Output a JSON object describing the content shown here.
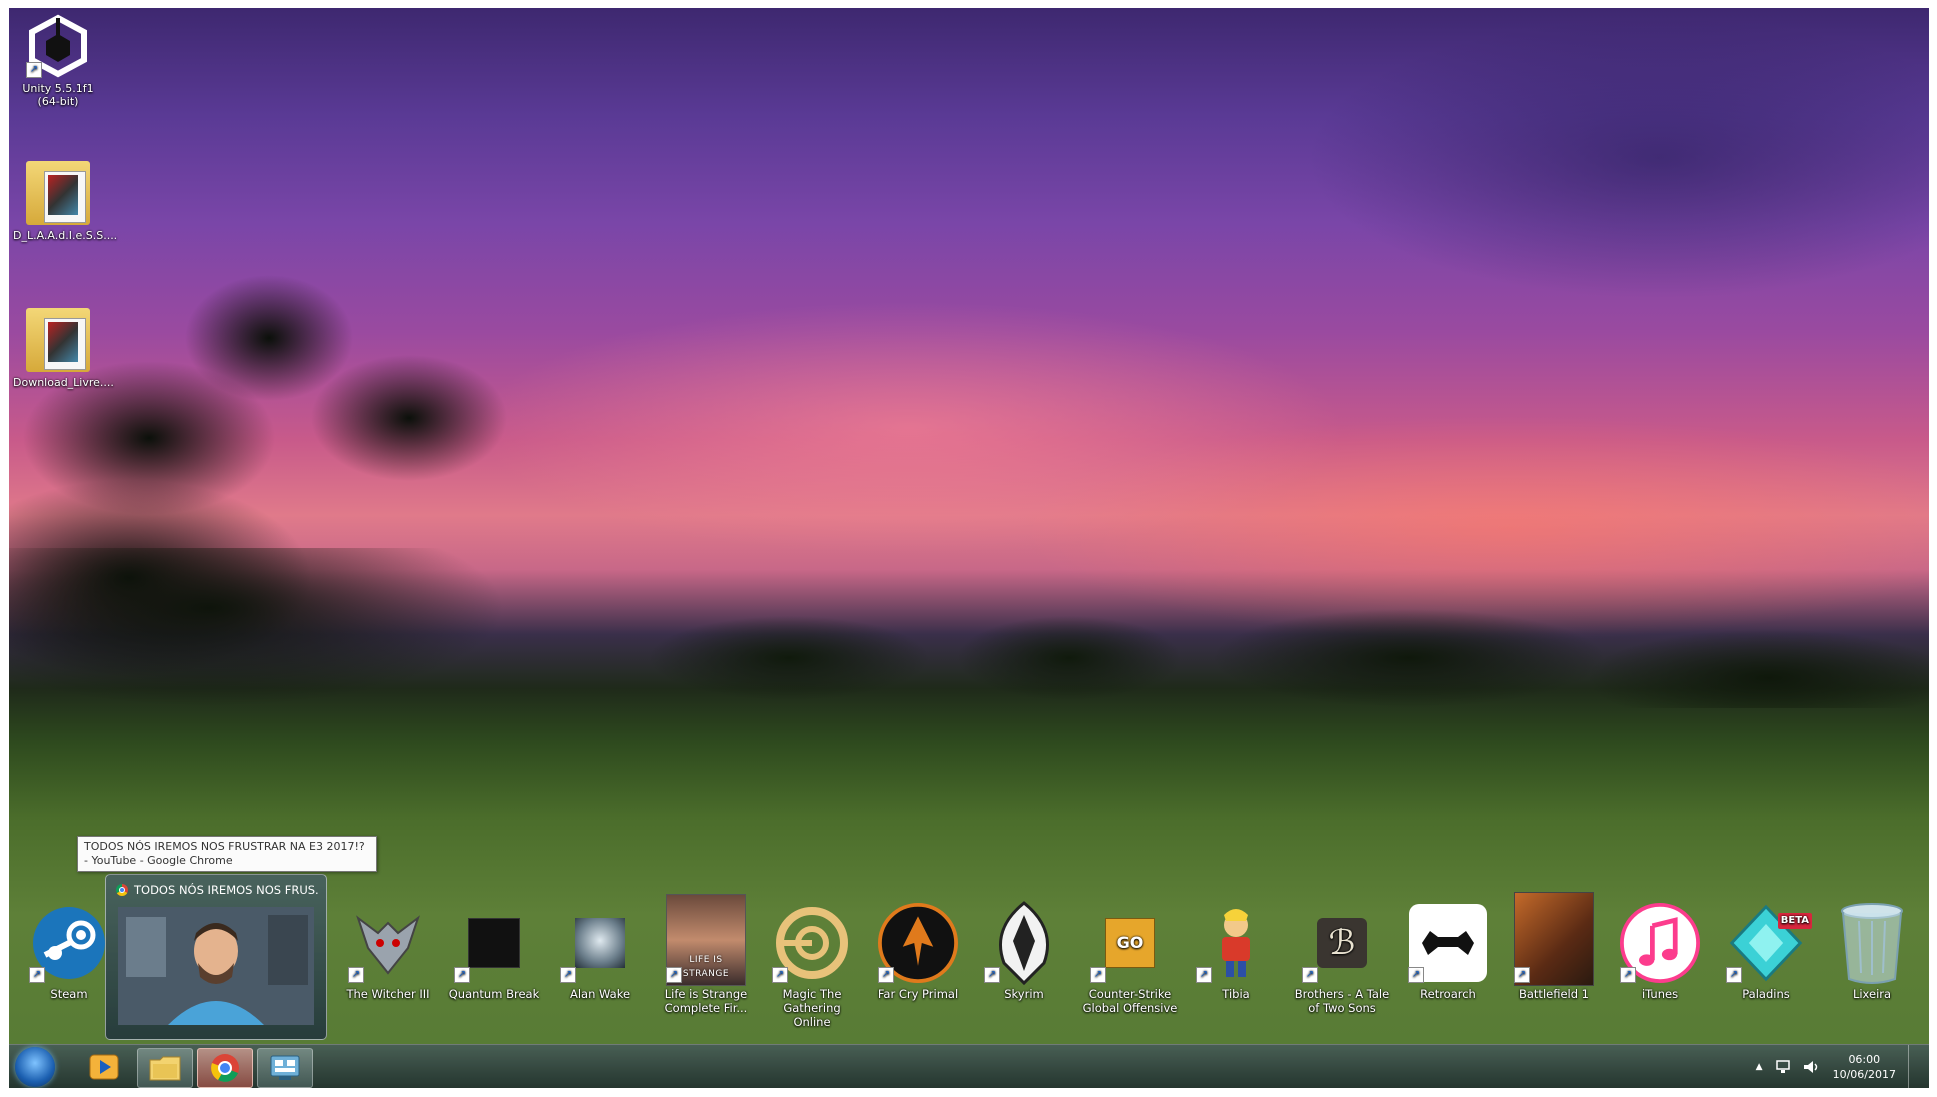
{
  "desktop": {
    "top_icons": [
      {
        "label": "Unity 5.5.1f1 (64-bit)",
        "icon": "unity-icon"
      },
      {
        "label": "D_L.A.A.d.I.e.S.S....",
        "icon": "folder-icon"
      },
      {
        "label": "Download_Livre....",
        "icon": "folder-icon"
      }
    ],
    "bottom_icons": [
      {
        "label": "Steam",
        "icon": "steam-icon"
      },
      {
        "label": "The Witcher III",
        "icon": "witcher-icon"
      },
      {
        "label": "Quantum Break",
        "icon": "quantum-break-icon"
      },
      {
        "label": "Alan Wake",
        "icon": "alan-wake-icon"
      },
      {
        "label": "Life is Strange Complete Fir...",
        "icon": "life-is-strange-icon"
      },
      {
        "label": "Magic The Gathering Online",
        "icon": "mtg-online-icon"
      },
      {
        "label": "Far Cry Primal",
        "icon": "far-cry-primal-icon"
      },
      {
        "label": "Skyrim",
        "icon": "skyrim-icon"
      },
      {
        "label": "Counter-Strike Global Offensive",
        "icon": "csgo-icon"
      },
      {
        "label": "Tibia",
        "icon": "tibia-icon"
      },
      {
        "label": "Brothers - A Tale of Two Sons",
        "icon": "brothers-icon"
      },
      {
        "label": "Retroarch",
        "icon": "retroarch-icon"
      },
      {
        "label": "Battlefield 1",
        "icon": "battlefield-icon"
      },
      {
        "label": "iTunes",
        "icon": "itunes-icon"
      },
      {
        "label": "Paladins",
        "icon": "paladins-icon",
        "badge": "BETA"
      },
      {
        "label": "Lixeira",
        "icon": "recycle-bin-icon"
      }
    ],
    "csgo_text": "GO",
    "life_is_strange_text": "LIFE IS STRANGE"
  },
  "tooltip": {
    "text": "TODOS NÓS IREMOS NOS FRUSTRAR NA E3 2017!? - YouTube - Google Chrome"
  },
  "preview": {
    "title": "TODOS NÓS IREMOS NOS FRUS..."
  },
  "taskbar": {
    "buttons": [
      {
        "icon": "media-player-icon",
        "state": "normal"
      },
      {
        "icon": "file-explorer-icon",
        "state": "open"
      },
      {
        "icon": "chrome-icon",
        "state": "active"
      },
      {
        "icon": "control-panel-icon",
        "state": "open"
      }
    ],
    "clock": {
      "time": "06:00",
      "date": "10/06/2017"
    },
    "tray_arrow": "▲"
  },
  "colors": {
    "steam": "#1b75bb",
    "itunes": "#fc3c8d",
    "paladins": "#3bd1d6",
    "far_cry": "#e07a1c"
  }
}
